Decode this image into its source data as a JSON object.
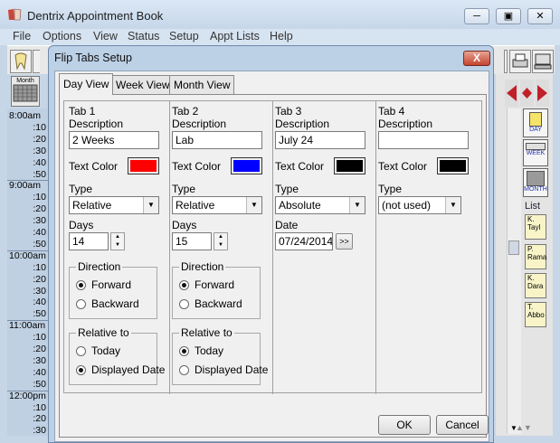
{
  "main_window": {
    "title": "Dentrix Appointment Book",
    "minimize_icon": "minimize-icon",
    "maximize_icon": "maximize-icon",
    "close_icon": "close-icon"
  },
  "menu": [
    "File",
    "Options",
    "View",
    "Status",
    "Setup",
    "Appt Lists",
    "Help"
  ],
  "left_panel": {
    "month_button": "Month",
    "times": [
      "8:00am",
      ":10",
      ":20",
      ":30",
      ":40",
      ":50",
      "9:00am",
      ":10",
      ":20",
      ":30",
      ":40",
      ":50",
      "10:00am",
      ":10",
      ":20",
      ":30",
      ":40",
      ":50",
      "11:00am",
      ":10",
      ":20",
      ":30",
      ":40",
      ":50",
      "12:00pm",
      ":10",
      ":20",
      ":30"
    ]
  },
  "right_panel": {
    "day_label": "DAY",
    "week_label": "WEEK",
    "month_label": "MONTH",
    "list_label": "List",
    "list_cards": [
      "K. Tayl",
      "P. Rama",
      "K. Dara",
      "T. Abbo"
    ],
    "partial_am": "am"
  },
  "dialog": {
    "title": "Flip Tabs Setup",
    "close_label": "X",
    "tabs": [
      "Day View",
      "Week View",
      "Month View"
    ],
    "active_tab": "Day View",
    "labels": {
      "description": "Description",
      "text_color": "Text Color",
      "type": "Type",
      "days": "Days",
      "date": "Date",
      "direction": "Direction",
      "forward": "Forward",
      "backward": "Backward",
      "relative_to": "Relative to",
      "today": "Today",
      "displayed_date": "Displayed Date"
    },
    "columns": [
      {
        "heading": "Tab 1",
        "description": "2 Weeks",
        "color": "#ff0000",
        "type": "Relative",
        "days": "14",
        "direction": "Forward",
        "relative_to": "Displayed Date"
      },
      {
        "heading": "Tab 2",
        "description": "Lab",
        "color": "#0000ff",
        "type": "Relative",
        "days": "15",
        "direction": "Forward",
        "relative_to": "Today"
      },
      {
        "heading": "Tab 3",
        "description": "July 24",
        "color": "#000000",
        "type": "Absolute",
        "date": "07/24/2014",
        "date_button": ">>"
      },
      {
        "heading": "Tab 4",
        "description": "",
        "color": "#000000",
        "type": "(not used)"
      }
    ],
    "ok_label": "OK",
    "cancel_label": "Cancel"
  }
}
